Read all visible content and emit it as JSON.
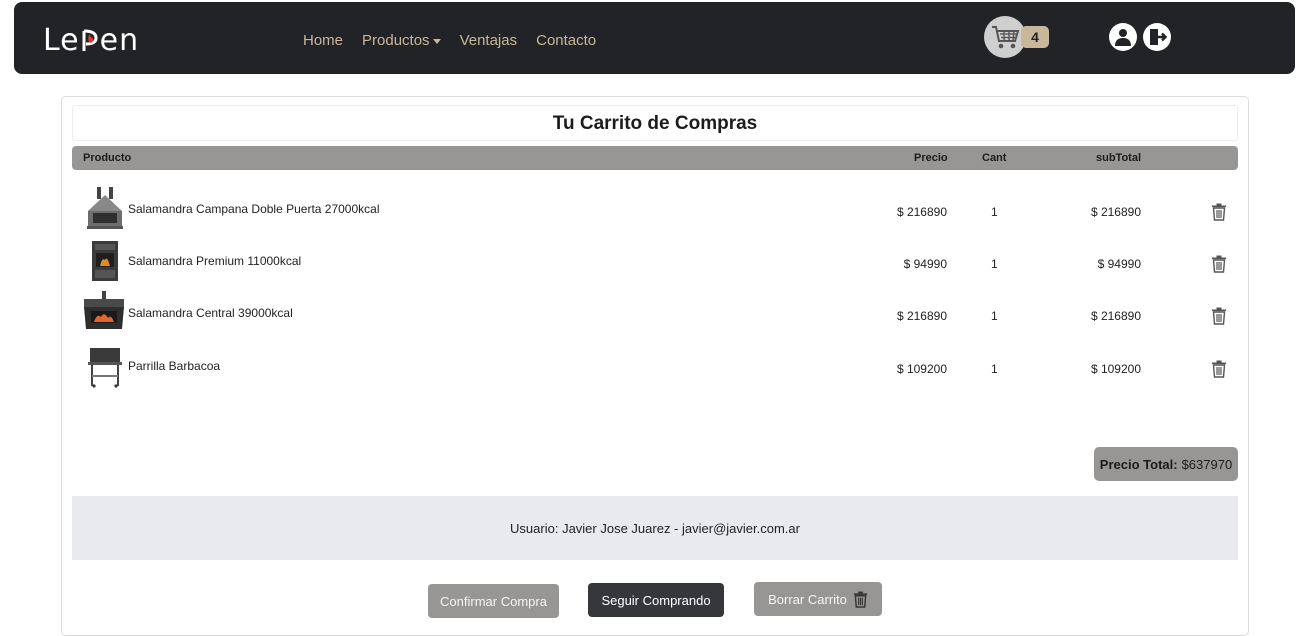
{
  "brand": {
    "logo_text": "LePen"
  },
  "nav": {
    "links": [
      "Home",
      "Productos",
      "Ventajas",
      "Contacto"
    ]
  },
  "header": {
    "cart_count": "4"
  },
  "cart": {
    "title": "Tu Carrito de Compras",
    "columns": {
      "product": "Producto",
      "price": "Precio",
      "qty": "Cant",
      "subtotal": "subTotal"
    },
    "items": [
      {
        "name": "Salamandra Campana Doble Puerta 27000kcal",
        "price": "$ 216890",
        "qty": "1",
        "subtotal": "$ 216890",
        "icon": "stove-campana-icon"
      },
      {
        "name": "Salamandra Premium 11000kcal",
        "price": "$ 94990",
        "qty": "1",
        "subtotal": "$ 94990",
        "icon": "stove-premium-icon"
      },
      {
        "name": "Salamandra Central 39000kcal",
        "price": "$ 216890",
        "qty": "1",
        "subtotal": "$ 216890",
        "icon": "stove-central-icon"
      },
      {
        "name": "Parrilla Barbacoa",
        "price": "$ 109200",
        "qty": "1",
        "subtotal": "$ 109200",
        "icon": "grill-icon"
      }
    ],
    "total_label": "Precio Total:",
    "total_value": "$637970",
    "user_line": "Usuario: Javier Jose Juarez - javier@javier.com.ar"
  },
  "actions": {
    "confirm": "Confirmar Compra",
    "continue": "Seguir Comprando",
    "clear": "Borrar Carrito"
  },
  "colors": {
    "navbar": "#222326",
    "nav_link": "#c8b79b",
    "table_header": "#989595",
    "user_strip": "#e8eaed",
    "dark_button": "#36373a"
  }
}
